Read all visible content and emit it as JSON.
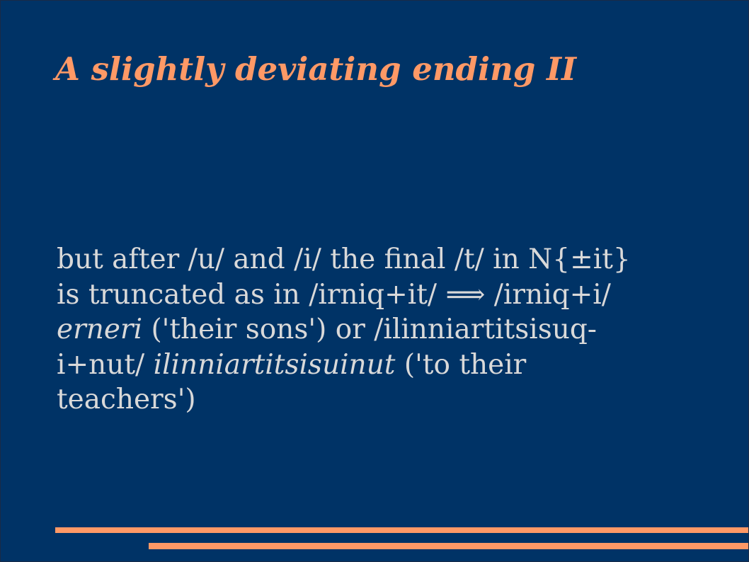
{
  "slide": {
    "title": "A slightly deviating ending II",
    "body": {
      "line1": "but after /u/ and /i/ the final /t/ in N{±it}",
      "line2": "is truncated as in /irniq+it/ ⟹ /irniq+i/",
      "line3_italic": "erneri",
      "line3_rest": " ('their sons') or /ilinniartitsisuq-",
      "line4_start": "i+nut/ ",
      "line4_italic": "ilinniartitsisuinut",
      "line4_rest": " ('to their",
      "line5": "teachers')"
    },
    "colors": {
      "background": "#003366",
      "accent": "#ff9966",
      "text": "#d9d9d9"
    }
  }
}
